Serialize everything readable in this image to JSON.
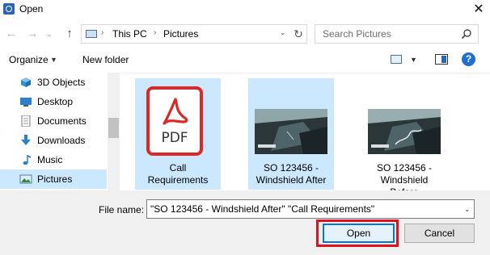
{
  "window": {
    "title": "Open",
    "close_glyph": "✕"
  },
  "nav": {
    "back_glyph": "←",
    "forward_glyph": "→",
    "recent_glyph": "⌄",
    "up_glyph": "↑",
    "breadcrumb": [
      "This PC",
      "Pictures"
    ],
    "sep_glyph": "›",
    "address_dropdown_glyph": "⌄",
    "refresh_glyph": "↻",
    "search_placeholder": "Search Pictures"
  },
  "toolbar": {
    "organize_label": "Organize",
    "caret_glyph": "▼",
    "new_folder_label": "New folder",
    "help_label": "?"
  },
  "sidebar": {
    "items": [
      {
        "label": "3D Objects",
        "icon": "cube-icon"
      },
      {
        "label": "Desktop",
        "icon": "desktop-icon"
      },
      {
        "label": "Documents",
        "icon": "documents-icon"
      },
      {
        "label": "Downloads",
        "icon": "download-icon"
      },
      {
        "label": "Music",
        "icon": "music-icon"
      },
      {
        "label": "Pictures",
        "icon": "pictures-icon",
        "selected": true
      }
    ]
  },
  "files": [
    {
      "name": "Call Requirements",
      "lines": [
        "Call",
        "Requirements"
      ],
      "type": "pdf",
      "selected": true,
      "badge": "PDF"
    },
    {
      "name": "SO 123456 - Windshield After",
      "lines": [
        "SO 123456 -",
        "Windshield After"
      ],
      "type": "image",
      "selected": true
    },
    {
      "name": "SO 123456 - Windshield Before",
      "lines": [
        "SO 123456 -",
        "Windshield",
        "Before"
      ],
      "type": "image",
      "selected": false
    }
  ],
  "footer": {
    "file_name_label": "File name:",
    "file_name_value": "\"SO 123456 - Windshield After\" \"Call Requirements\"",
    "dropdown_glyph": "⌄",
    "open_label": "Open",
    "cancel_label": "Cancel"
  },
  "colors": {
    "accent": "#0078d7",
    "selection": "#cce8ff",
    "highlight_box": "#e0101e",
    "pdf_red": "#e02727"
  }
}
